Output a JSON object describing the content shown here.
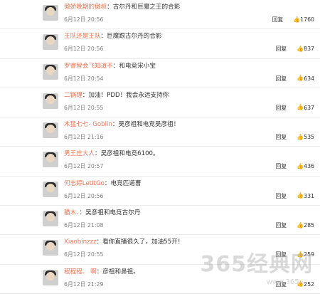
{
  "comments": [
    {
      "user": "傲娇晚期的傲叔",
      "text": "：古尔丹和巨魔之王的合影",
      "date": "6月12日 20:56",
      "reply": "回复",
      "likes": "1760"
    },
    {
      "user": "王队还是王队",
      "text": "：巨魔跟古尔丹的合影",
      "date": "6月12日 20:56",
      "reply": "回复",
      "likes": "837"
    },
    {
      "user": "罗睿智会飞知道不",
      "text": "：和电竞宋小宝",
      "date": "6月12日 20:54",
      "reply": "回复",
      "likes": "634"
    },
    {
      "user": "二锅锂",
      "text": "：加油！PDD！我会永远支持你",
      "date": "6月12日 20:55",
      "reply": "回复",
      "likes": "637"
    },
    {
      "user": "木猛七七- Goblin",
      "text": "：吴彦祖和电竞吴彦祖！",
      "date": "6月12日 21:16",
      "reply": "回复",
      "likes": "535"
    },
    {
      "user": "男王庄大人",
      "text": "：吴彦祖和电竞6100。",
      "date": "6月12日 20:57",
      "reply": "回复",
      "likes": "436"
    },
    {
      "user": "何志婷LetItGo",
      "text": "：电竞匹诺曹",
      "date": "6月12日 20:56",
      "reply": "回复",
      "likes": "331"
    },
    {
      "user": "猫木、",
      "text": "：吴彦祖和电竞古尔丹",
      "date": "6月12日 21:08",
      "reply": "回复",
      "likes": "285"
    },
    {
      "user": "Xiaobinzzz",
      "text": "：看你直播很久了，加油55开！",
      "date": "6月12日 20:55",
      "reply": "回复",
      "likes": "259"
    },
    {
      "user": "程程程、 啊",
      "text": "：彦祖和鼻祖。",
      "date": "6月12日 21:29",
      "reply": "回复",
      "likes": "252"
    }
  ],
  "watermark": {
    "text": "365经典网",
    "url": "www.365..."
  }
}
